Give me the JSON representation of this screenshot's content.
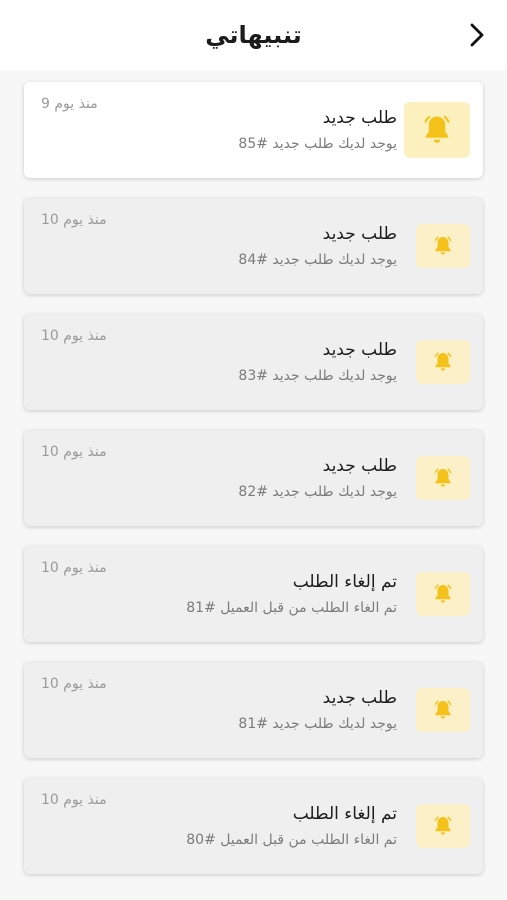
{
  "header": {
    "title": "تنبيهاتي"
  },
  "notifications": [
    {
      "title": "طلب جديد",
      "subtitle": "يوجد لديك طلب جديد #85",
      "time": "منذ يوم 9",
      "unread": true
    },
    {
      "title": "طلب جديد",
      "subtitle": "يوجد لديك طلب جديد #84",
      "time": "منذ يوم 10",
      "unread": false
    },
    {
      "title": "طلب جديد",
      "subtitle": "يوجد لديك طلب جديد #83",
      "time": "منذ يوم 10",
      "unread": false
    },
    {
      "title": "طلب جديد",
      "subtitle": "يوجد لديك طلب جديد #82",
      "time": "منذ يوم 10",
      "unread": false
    },
    {
      "title": "تم إلغاء الطلب",
      "subtitle": "تم الغاء الطلب من قبل العميل #81",
      "time": "منذ يوم 10",
      "unread": false
    },
    {
      "title": "طلب جديد",
      "subtitle": "يوجد لديك طلب جديد #81",
      "time": "منذ يوم 10",
      "unread": false
    },
    {
      "title": "تم إلغاء الطلب",
      "subtitle": "تم الغاء الطلب من قبل العميل #80",
      "time": "منذ يوم 10",
      "unread": false
    }
  ],
  "icons": {
    "back": "chevron-right-icon",
    "notification": "bell-icon"
  },
  "colors": {
    "bell": "#f5c21b",
    "icon_bg": "#fbf0c8"
  }
}
